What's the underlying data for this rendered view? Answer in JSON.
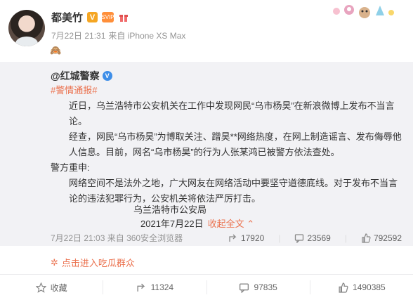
{
  "post": {
    "author_name": "都美竹",
    "verified_badge": "V",
    "svip_badge": "SVIP",
    "timestamp": "7月22日 21:31",
    "via_label": "来自 iPhone XS Max",
    "body_emoji": "🙈"
  },
  "retweet": {
    "author": "@红城警察",
    "tag": "#警情通报#",
    "paragraphs": [
      "近日，乌兰浩特市公安机关在工作中发现网民“乌市杨昊”在新浪微博上发布不当言论。",
      "经查，网民“乌市杨昊”为博取关注、蹭昊**网络热度，在网上制造谣言、发布侮辱他人信息。目前，网名“乌市杨昊”的行为人张某鸿已被警方依法查处。",
      "警方重申:",
      "网络空间不是法外之地，广大网友在网络活动中要坚守道德底线。对于发布不当言论的违法犯罪行为，公安机关将依法严厉打击。"
    ],
    "signature": "乌兰浩特市公安局",
    "date": "2021年7月22日",
    "collapse_label": "收起全文",
    "footer_time": "7月22日 21:03",
    "footer_via": "来自 360安全浏览器",
    "stats": {
      "shares": "17920",
      "comments": "23569",
      "likes": "792592"
    }
  },
  "chaogua_label": "点击进入吃瓜群众",
  "toolbar": {
    "favorite": "收藏",
    "shares": "11324",
    "comments": "97835",
    "likes": "1490385"
  },
  "colors": {
    "accent": "#eb7350",
    "meta_gray": "#939393",
    "retweet_bg": "#f2f2f5",
    "verified_blue": "#3e8ee8",
    "verified_gold": "#f5a623"
  }
}
